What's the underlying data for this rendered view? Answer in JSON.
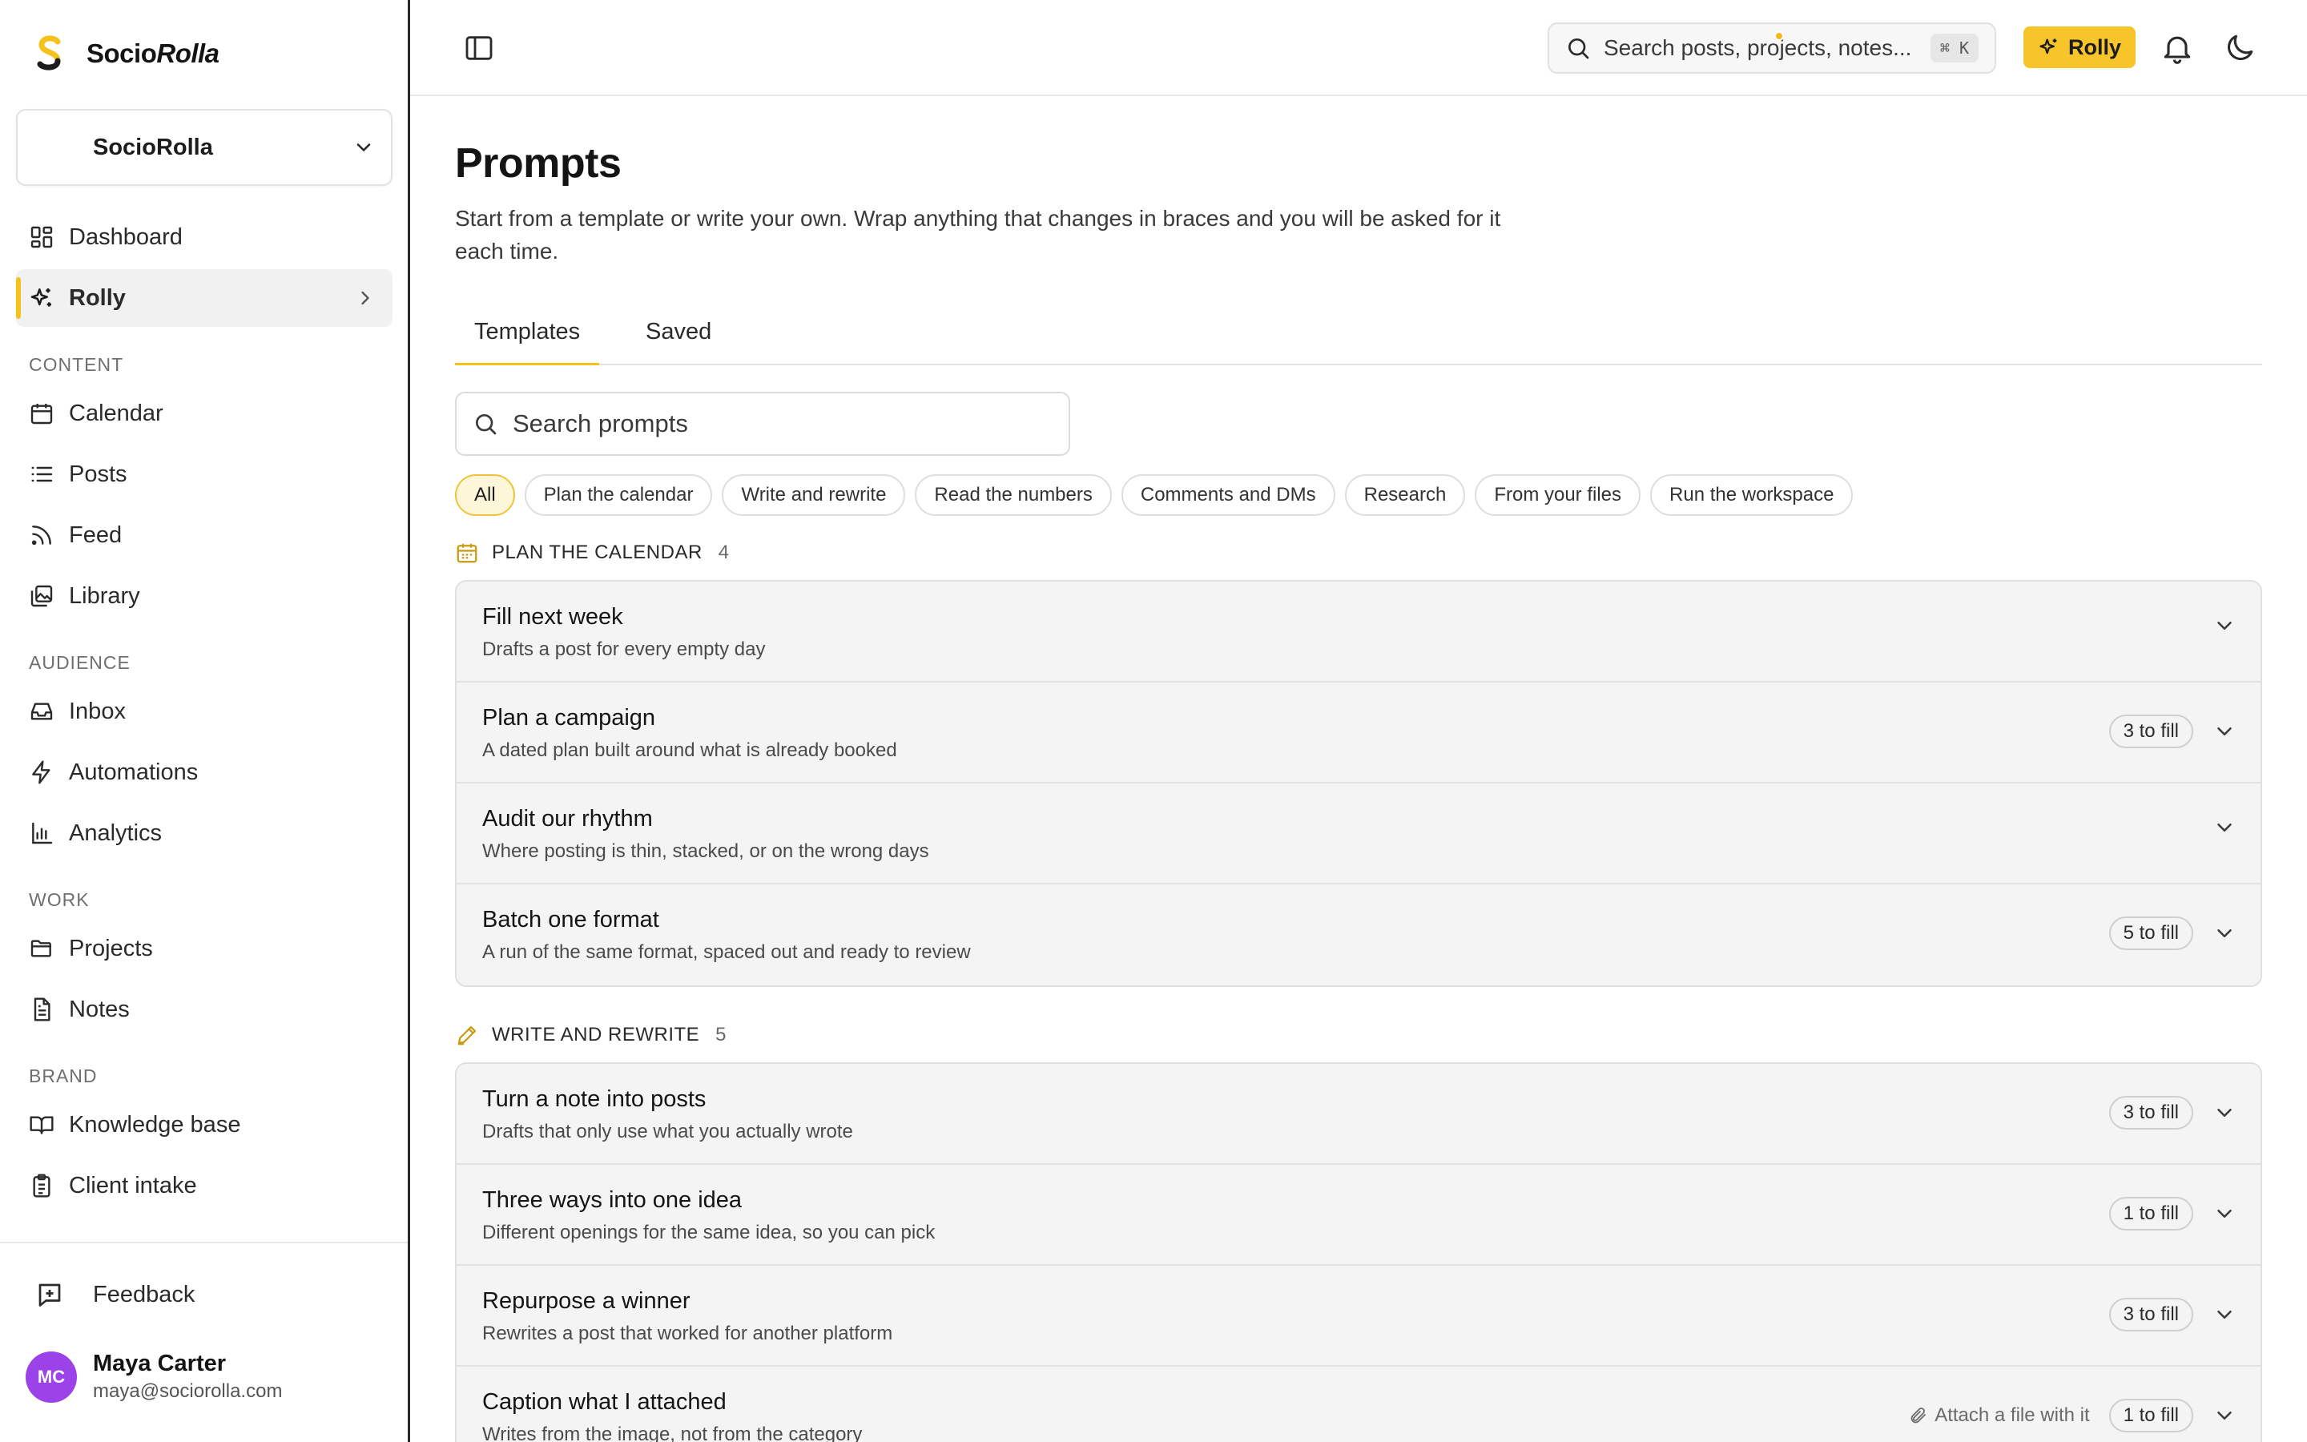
{
  "brand": {
    "name_a": "Socio",
    "name_b": "Rolla"
  },
  "workspace": {
    "label": "SocioRolla"
  },
  "nav": {
    "dashboard": "Dashboard",
    "rolly": "Rolly",
    "content_label": "CONTENT",
    "calendar": "Calendar",
    "posts": "Posts",
    "feed": "Feed",
    "library": "Library",
    "audience_label": "AUDIENCE",
    "inbox": "Inbox",
    "automations": "Automations",
    "analytics": "Analytics",
    "work_label": "WORK",
    "projects": "Projects",
    "notes": "Notes",
    "brand_label": "BRAND",
    "knowledge_base": "Knowledge base",
    "client_intake": "Client intake",
    "feedback": "Feedback"
  },
  "user": {
    "initials": "MC",
    "name": "Maya Carter",
    "email": "maya@sociorolla.com"
  },
  "topbar": {
    "search_placeholder": "Search posts, projects, notes...",
    "shortcut": "⌘ K",
    "rolly_label": "Rolly"
  },
  "page": {
    "title": "Prompts",
    "description": "Start from a template or write your own. Wrap anything that changes in braces and you will be asked for it each time.",
    "tabs": {
      "templates": "Templates",
      "saved": "Saved"
    },
    "search_placeholder": "Search prompts",
    "filters": [
      "All",
      "Plan the calendar",
      "Write and rewrite",
      "Read the numbers",
      "Comments and DMs",
      "Research",
      "From your files",
      "Run the workspace"
    ]
  },
  "groups": [
    {
      "title": "PLAN THE CALENDAR",
      "count": "4",
      "items": [
        {
          "title": "Fill next week",
          "desc": "Drafts a post for every empty day",
          "badge": ""
        },
        {
          "title": "Plan a campaign",
          "desc": "A dated plan built around what is already booked",
          "badge": "3 to fill"
        },
        {
          "title": "Audit our rhythm",
          "desc": "Where posting is thin, stacked, or on the wrong days",
          "badge": ""
        },
        {
          "title": "Batch one format",
          "desc": "A run of the same format, spaced out and ready to review",
          "badge": "5 to fill"
        }
      ]
    },
    {
      "title": "WRITE AND REWRITE",
      "count": "5",
      "items": [
        {
          "title": "Turn a note into posts",
          "desc": "Drafts that only use what you actually wrote",
          "badge": "3 to fill"
        },
        {
          "title": "Three ways into one idea",
          "desc": "Different openings for the same idea, so you can pick",
          "badge": "1 to fill"
        },
        {
          "title": "Repurpose a winner",
          "desc": "Rewrites a post that worked for another platform",
          "badge": "3 to fill"
        },
        {
          "title": "Caption what I attached",
          "desc": "Writes from the image, not from the category",
          "badge": "1 to fill",
          "attach": "Attach a file with it"
        }
      ]
    }
  ],
  "colors": {
    "accent": "#f7c52a",
    "avatar": "#9b42e8",
    "active_bar": "#f4c21b"
  }
}
